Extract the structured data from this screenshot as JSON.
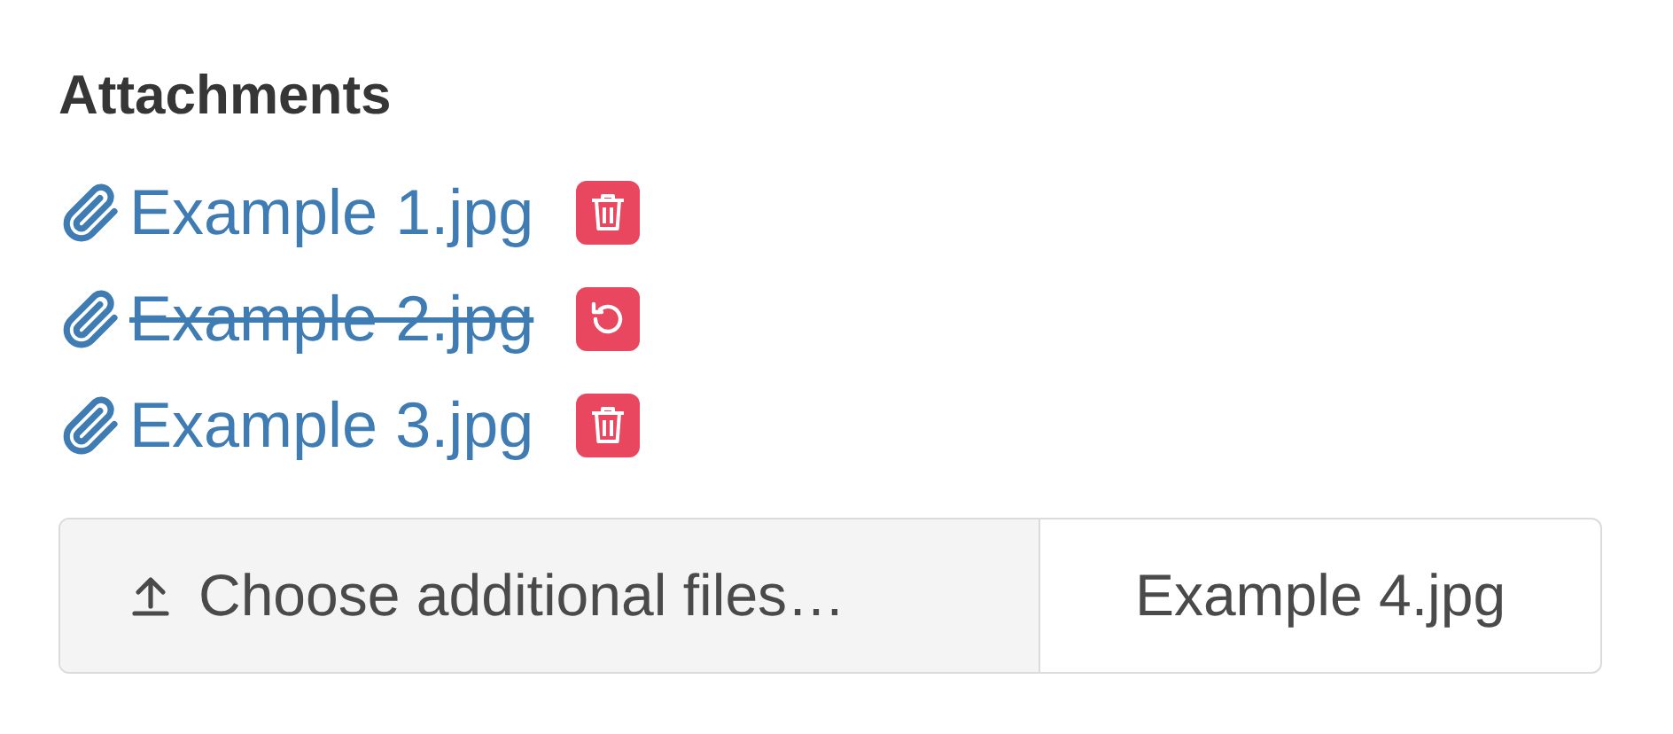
{
  "heading": "Attachments",
  "attachments": [
    {
      "name": "Example 1.jpg",
      "removed": false
    },
    {
      "name": "Example 2.jpg",
      "removed": true
    },
    {
      "name": "Example 3.jpg",
      "removed": false
    }
  ],
  "file_input": {
    "button_label": "Choose additional files…",
    "file_name": "Example 4.jpg"
  }
}
